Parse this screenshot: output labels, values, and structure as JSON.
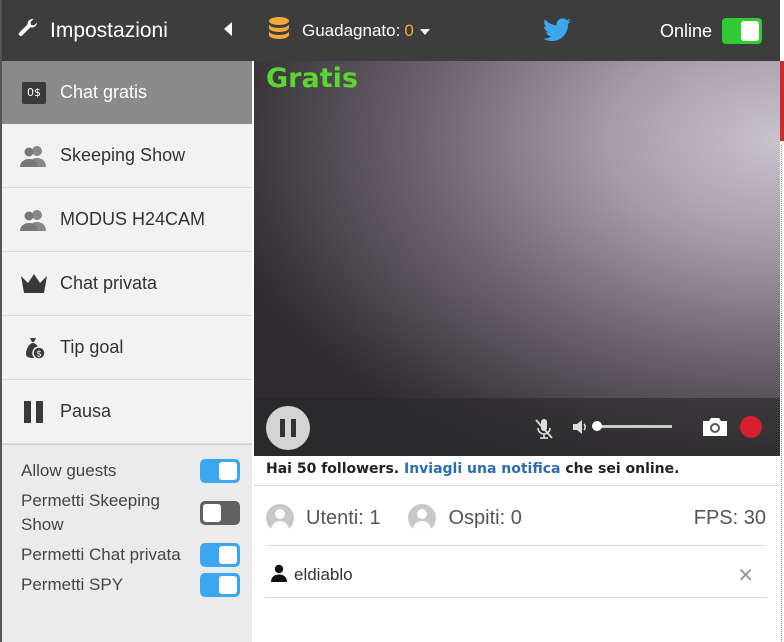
{
  "sidebar": {
    "title": "Impostazioni",
    "items": [
      {
        "label": "Chat gratis",
        "badge": "0$",
        "active": true
      },
      {
        "label": "Skeeping Show"
      },
      {
        "label": "MODUS H24CAM"
      },
      {
        "label": "Chat privata"
      },
      {
        "label": "Tip goal"
      },
      {
        "label": "Pausa"
      }
    ],
    "toggles": [
      {
        "label": "Allow guests",
        "on": true
      },
      {
        "label": "Permetti Skeeping Show",
        "on": false
      },
      {
        "label": "Permetti Chat privata",
        "on": true
      },
      {
        "label": "Permetti SPY",
        "on": true
      }
    ]
  },
  "topbar": {
    "earned_label": "Guadagnato:",
    "earned_value": "0",
    "online_label": "Online",
    "online_on": true
  },
  "video": {
    "overlay_label": "Gratis"
  },
  "notice": {
    "before": "Hai 50 followers. ",
    "link": "Inviagli una notifica",
    "after": " che sei online."
  },
  "stats": {
    "users": "Utenti: 1",
    "guests": "Ospiti: 0",
    "fps": "FPS: 30"
  },
  "user_list": [
    {
      "name": "eldiablo"
    }
  ],
  "colors": {
    "accent_blue": "#3aa7f0",
    "online_green": "#2fcc34",
    "gratis_green": "#5cd630",
    "earned_orange": "#f1a93a",
    "record_red": "#d71f2d",
    "link_blue": "#2a6db0"
  }
}
